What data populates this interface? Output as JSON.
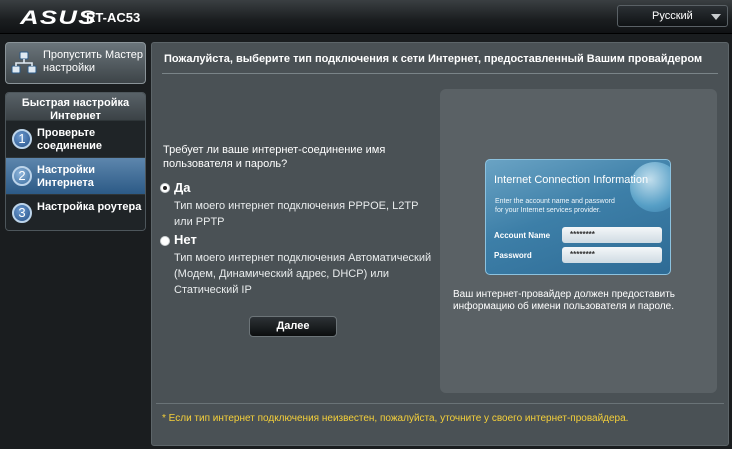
{
  "header": {
    "brand": "ASUS",
    "model": "RT-AC53",
    "language": "Русский"
  },
  "sidebar": {
    "skip_button": "Пропустить Мастер настройки",
    "menu_title": "Быстрая настройка Интернет",
    "steps": [
      {
        "number": "1",
        "label": "Проверьте соединение",
        "active": false
      },
      {
        "number": "2",
        "label": "Настройки Интернета",
        "active": true
      },
      {
        "number": "3",
        "label": "Настройка роутера",
        "active": false
      }
    ]
  },
  "main": {
    "title": "Пожалуйста, выберите тип подключения к сети Интернет, предоставленный Вашим провайдером",
    "question": "Требует ли ваше интернет-соединение имя пользователя и пароль?",
    "options": [
      {
        "label": "Да",
        "checked": true,
        "description": "Тип моего интернет подключения PPPOE, L2TP или PPTP"
      },
      {
        "label": "Нет",
        "checked": false,
        "description": "Тип моего интернет подключения Автоматический (Модем, Динамический адрес, DHCP) или Статический IP"
      }
    ],
    "next_button": "Далее",
    "info_card": {
      "title": "Internet Connection Information",
      "subtitle": "Enter the account name and password for your Internet services provider.",
      "account_label": "Account Name",
      "account_value": "********",
      "password_label": "Password",
      "password_value": "********"
    },
    "info_text": "Ваш интернет-провайдер должен предоставить информацию об имени пользователя и пароле.",
    "footnote": "* Если тип интернет подключения неизвестен, пожалуйста, уточните у своего интернет-провайдера."
  }
}
